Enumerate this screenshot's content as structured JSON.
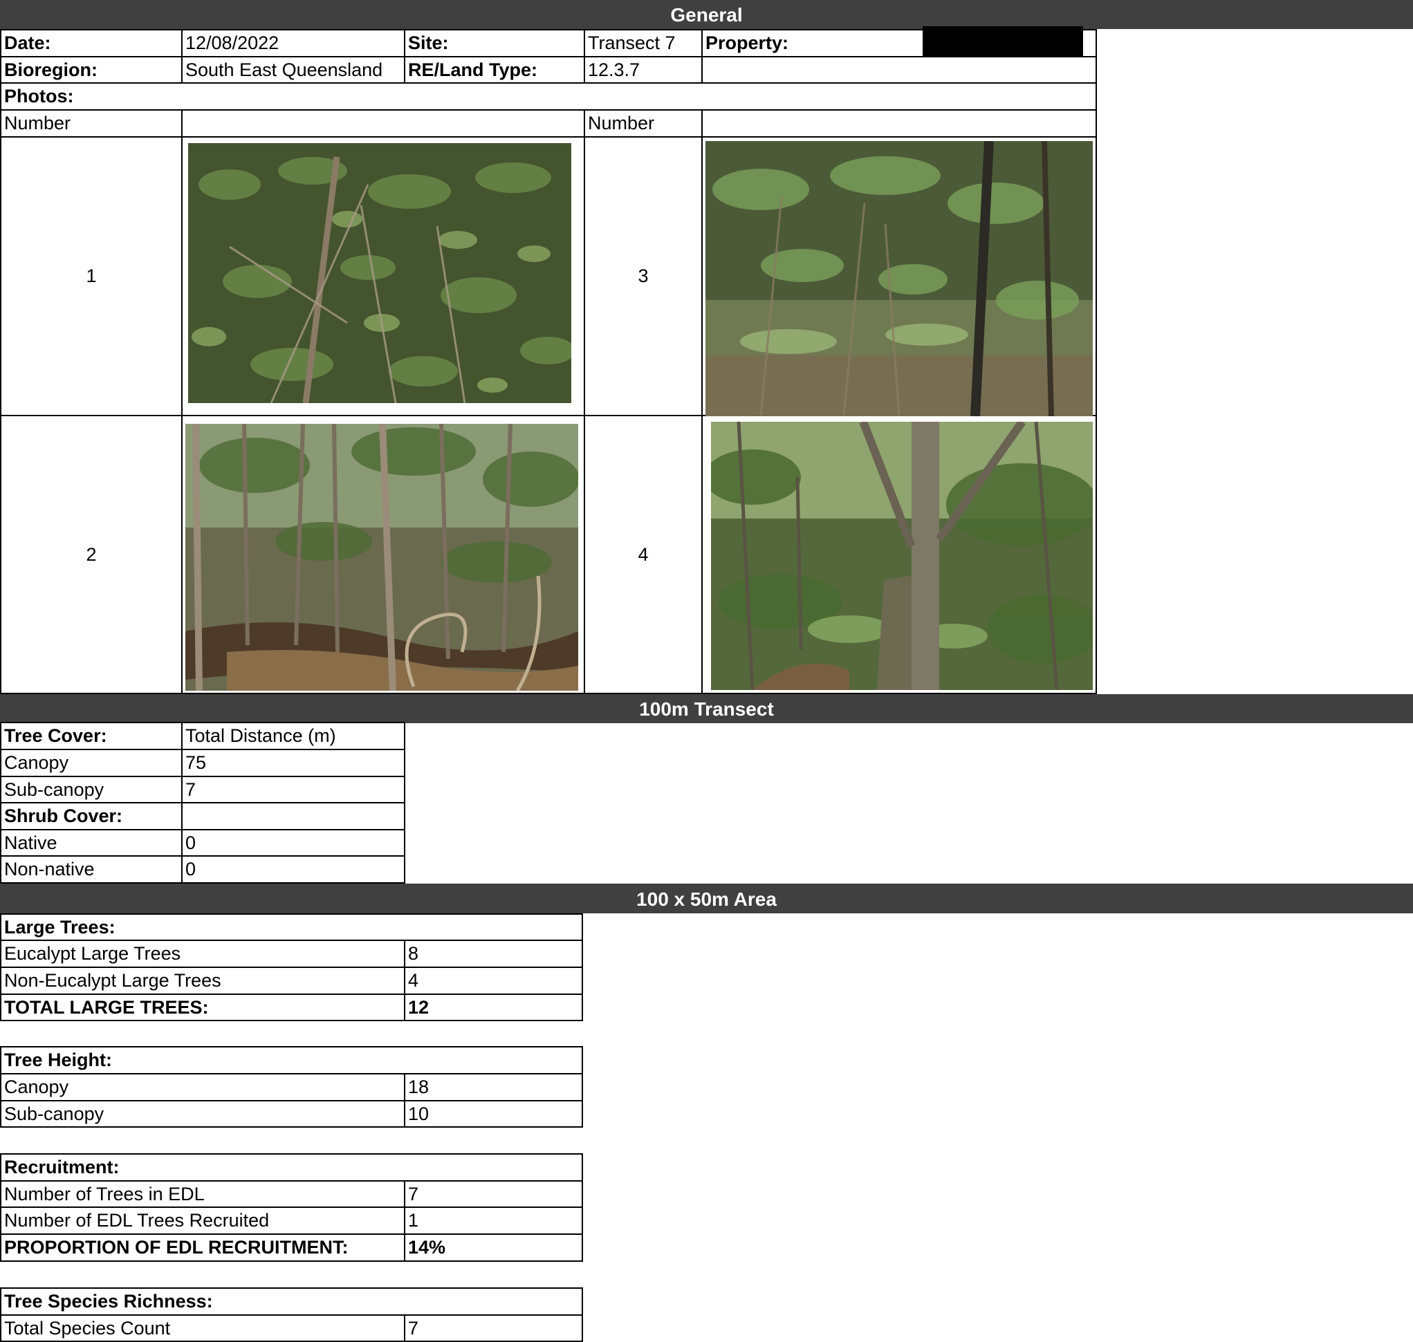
{
  "sections": {
    "general": "General",
    "transect": "100m Transect",
    "area": "100 x 50m Area"
  },
  "general": {
    "date_label": "Date:",
    "date_value": "12/08/2022",
    "site_label": "Site:",
    "site_value": "Transect 7",
    "property_label": "Property:",
    "bioregion_label": "Bioregion:",
    "bioregion_value": "South East Queensland",
    "re_label": "RE/Land Type:",
    "re_value": "12.3.7"
  },
  "photos": {
    "label": "Photos:",
    "number_header_left": "Number",
    "number_header_right": "Number",
    "items": [
      {
        "number": "1"
      },
      {
        "number": "2"
      },
      {
        "number": "3"
      },
      {
        "number": "4"
      }
    ]
  },
  "transect": {
    "tree_cover_label": "Tree Cover:",
    "total_distance_label": "Total Distance (m)",
    "canopy_label": "Canopy",
    "canopy_value": "75",
    "subcanopy_label": "Sub-canopy",
    "subcanopy_value": "7",
    "shrub_cover_label": "Shrub Cover:",
    "native_label": "Native",
    "native_value": "0",
    "nonnative_label": "Non-native",
    "nonnative_value": "0"
  },
  "area": {
    "large_trees_label": "Large Trees:",
    "eucalypt_label": "Eucalypt Large Trees",
    "eucalypt_value": "8",
    "noneucalypt_label": "Non-Eucalypt Large Trees",
    "noneucalypt_value": "4",
    "total_label": "TOTAL LARGE TREES:",
    "total_value": "12",
    "tree_height_label": "Tree Height:",
    "height_canopy_label": "Canopy",
    "height_canopy_value": "18",
    "height_subcanopy_label": "Sub-canopy",
    "height_subcanopy_value": "10",
    "recruitment_label": "Recruitment:",
    "edl_trees_label": "Number of Trees in EDL",
    "edl_trees_value": "7",
    "edl_recruited_label": "Number of EDL Trees Recruited",
    "edl_recruited_value": "1",
    "proportion_label": "PROPORTION OF EDL RECRUITMENT:",
    "proportion_value": "14%",
    "richness_label": "Tree Species Richness:",
    "species_count_label": "Total Species Count",
    "species_count_value": "7"
  }
}
